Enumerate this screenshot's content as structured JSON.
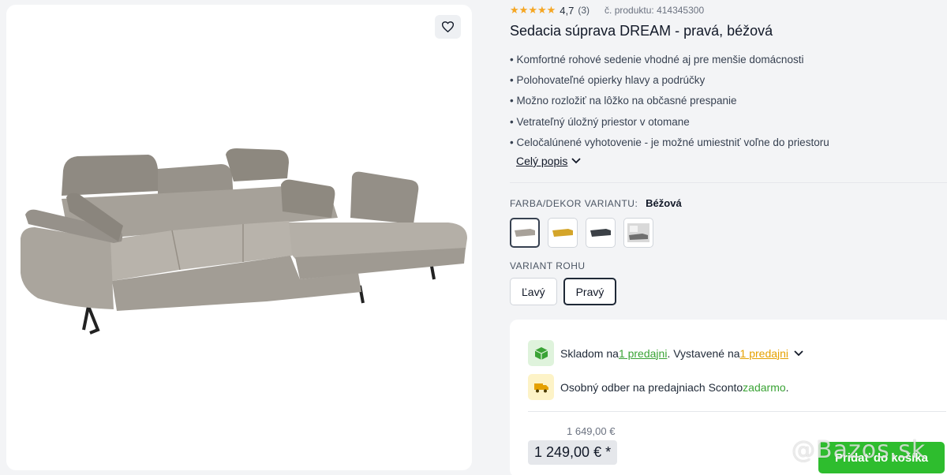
{
  "product": {
    "rating": "4,7",
    "rating_count": "(3)",
    "stars": 4.7,
    "code": "č. produktu: 414345300",
    "title": "Sedacia súprava DREAM - pravá, béžová"
  },
  "bullets": [
    "Komfortné rohové sedenie vhodné aj pre menšie domácnosti",
    "Polohovateľné opierky hlavy a podrúčky",
    "Možno rozložiť na lôžko na občasné prespanie",
    "Vetrateľný úložný priestor v otomane",
    "Celočalúnené vyhotovenie - je možné umiestniť voľne do priestoru"
  ],
  "full_description_link": "Celý popis",
  "color_variant": {
    "label": "FARBA/DEKOR VARIANTU:",
    "selected_value": "Béžová",
    "swatches": [
      {
        "name": "beige",
        "color": "#a8a29a",
        "selected": true
      },
      {
        "name": "yellow",
        "color": "#d4a52a",
        "selected": false
      },
      {
        "name": "dark",
        "color": "#3b4046",
        "selected": false
      },
      {
        "name": "grey-room",
        "color": "#8c8c8c",
        "selected": false
      }
    ]
  },
  "corner_variant": {
    "label": "VARIANT ROHU",
    "options": [
      "Ľavý",
      "Pravý"
    ],
    "selected": "Pravý"
  },
  "availability": {
    "stock_prefix": "Skladom na ",
    "stock_link": "1 predajni",
    "stock_mid": ". Vystavené na ",
    "display_link": "1 predajni",
    "pickup_prefix": "Osobný odber na predajniach Sconto ",
    "pickup_free": "zadarmo",
    "pickup_suffix": "."
  },
  "price": {
    "old": "1 649,00 €",
    "current": "1 249,00 € *"
  },
  "cart_button": "Pridať do košíka",
  "watermark": "@Bazos.sk",
  "colors": {
    "accent_green": "#2ebd2e",
    "link_green": "#3aa335",
    "link_orange": "#e5a100",
    "star": "#f5a623"
  }
}
